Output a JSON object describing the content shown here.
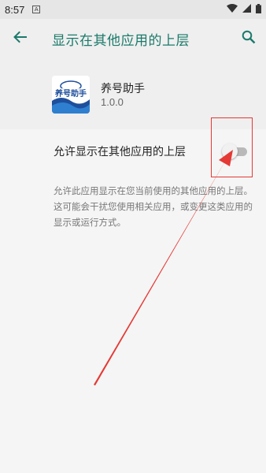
{
  "status_bar": {
    "time": "8:57",
    "notification_icon": "a-badge-icon",
    "wifi_icon": "wifi-icon",
    "signal_icon": "signal-icon",
    "battery_icon": "battery-icon"
  },
  "app_bar": {
    "title": "显示在其他应用的上层",
    "back_icon": "arrow-back-icon",
    "search_icon": "search-icon"
  },
  "app_info": {
    "name": "养号助手",
    "version": "1.0.0",
    "icon_text": "养号助手"
  },
  "setting": {
    "label": "允许显示在其他应用的上层",
    "enabled": false,
    "description": "允许此应用显示在您当前使用的其他应用的上层。这可能会干扰您使用相关应用，或变更这类应用的显示或运行方式。"
  },
  "colors": {
    "accent": "#1b7a6a",
    "annotation": "#e53935"
  }
}
